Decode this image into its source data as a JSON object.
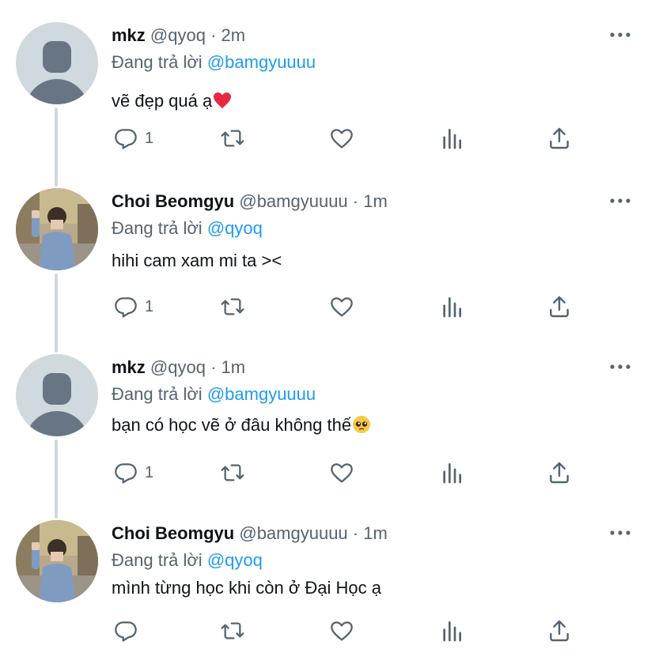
{
  "tweets": [
    {
      "name": "mkz",
      "handle": "@qyoq",
      "separator": "·",
      "time": "2m",
      "reply_prefix": "Đang trả lời",
      "reply_to": "@bamgyuuuu",
      "text": "vẽ đẹp quá ạ",
      "emoji": "heart-emoji",
      "reply_count": "1",
      "avatar": "default-avatar"
    },
    {
      "name": "Choi Beomgyu",
      "handle": "@bamgyuuuu",
      "separator": "·",
      "time": "1m",
      "reply_prefix": "Đang trả lời",
      "reply_to": "@qyoq",
      "text": "hihi cam xam mi ta ><",
      "reply_count": "1",
      "avatar": "photo-avatar"
    },
    {
      "name": "mkz",
      "handle": "@qyoq",
      "separator": "·",
      "time": "1m",
      "reply_prefix": "Đang trả lời",
      "reply_to": "@bamgyuuuu",
      "text": "bạn có học vẽ ở đâu không thế",
      "emoji": "pleading-face-emoji",
      "reply_count": "1",
      "avatar": "default-avatar"
    },
    {
      "name": "Choi Beomgyu",
      "handle": "@bamgyuuuu",
      "separator": "·",
      "time": "1m",
      "reply_prefix": "Đang trả lời",
      "reply_to": "@qyoq",
      "text": "mình từng học khi còn ở Đại Học ạ",
      "reply_count": "",
      "avatar": "photo-avatar"
    }
  ],
  "icons": {
    "reply": "reply-icon",
    "retweet": "retweet-icon",
    "like": "like-icon",
    "analytics": "analytics-icon",
    "share": "share-icon",
    "more": "more-icon"
  },
  "colors": {
    "accent": "#1d9bf0",
    "secondary_text": "#536471",
    "thread_line": "#cfd9de"
  }
}
